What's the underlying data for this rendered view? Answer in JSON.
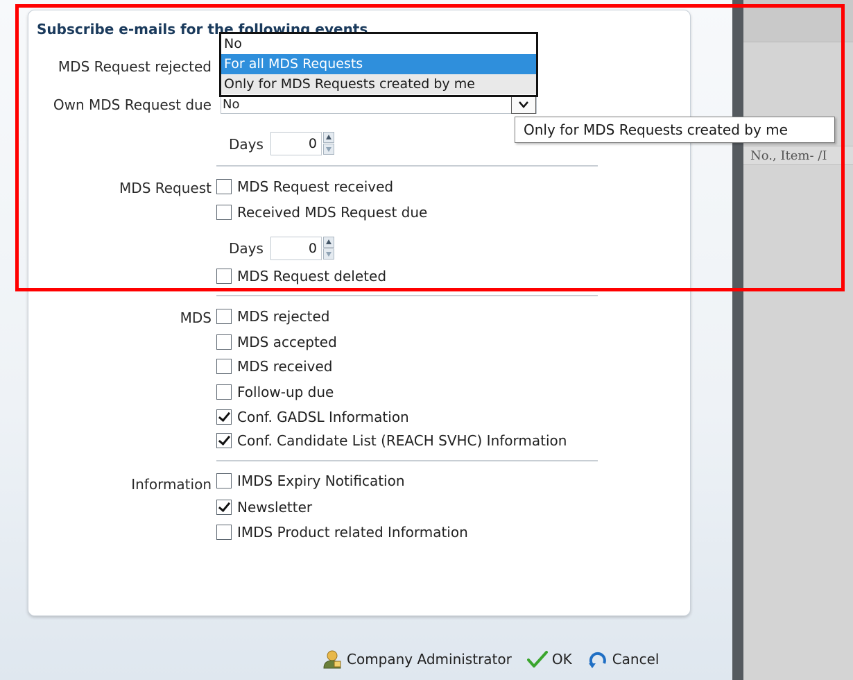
{
  "heading": "Subscribe e-mails for the following events",
  "rows": {
    "mds_request_rejected_label": "MDS Request rejected",
    "own_mds_request_due_label": "Own MDS Request due",
    "own_mds_request_due_value": "No",
    "days_label": "Days",
    "days_value_1": "0",
    "days_value_2": "0"
  },
  "dropdown": {
    "options": [
      "No",
      "For all MDS Requests",
      "Only for MDS Requests created by me"
    ],
    "selected_index": 1,
    "hover_index": 2
  },
  "tooltip": "Only for MDS Requests created by me",
  "sections": {
    "mds_request": {
      "label": "MDS Request",
      "items": [
        {
          "label": "MDS Request received",
          "checked": false
        },
        {
          "label": "Received MDS Request due",
          "checked": false
        },
        {
          "label": "MDS Request deleted",
          "checked": false
        }
      ]
    },
    "mds": {
      "label": "MDS",
      "items": [
        {
          "label": "MDS rejected",
          "checked": false
        },
        {
          "label": "MDS accepted",
          "checked": false
        },
        {
          "label": "MDS received",
          "checked": false
        },
        {
          "label": "Follow-up due",
          "checked": false
        },
        {
          "label": "Conf. GADSL Information",
          "checked": true
        },
        {
          "label": "Conf. Candidate List (REACH SVHC) Information",
          "checked": true
        }
      ]
    },
    "information": {
      "label": "Information",
      "items": [
        {
          "label": "IMDS Expiry Notification",
          "checked": false
        },
        {
          "label": "Newsletter",
          "checked": true
        },
        {
          "label": "IMDS Product related Information",
          "checked": false
        }
      ]
    }
  },
  "footer": {
    "company_admin": "Company Administrator",
    "ok": "OK",
    "cancel": "Cancel"
  },
  "background_table": {
    "column_header": "No., Item- /I"
  },
  "colors": {
    "highlight": "#2f8fdc",
    "annotation_frame": "#ff0000",
    "heading": "#1a3a5c",
    "ok_check": "#3aa52d",
    "cancel": "#1f6fc4"
  }
}
